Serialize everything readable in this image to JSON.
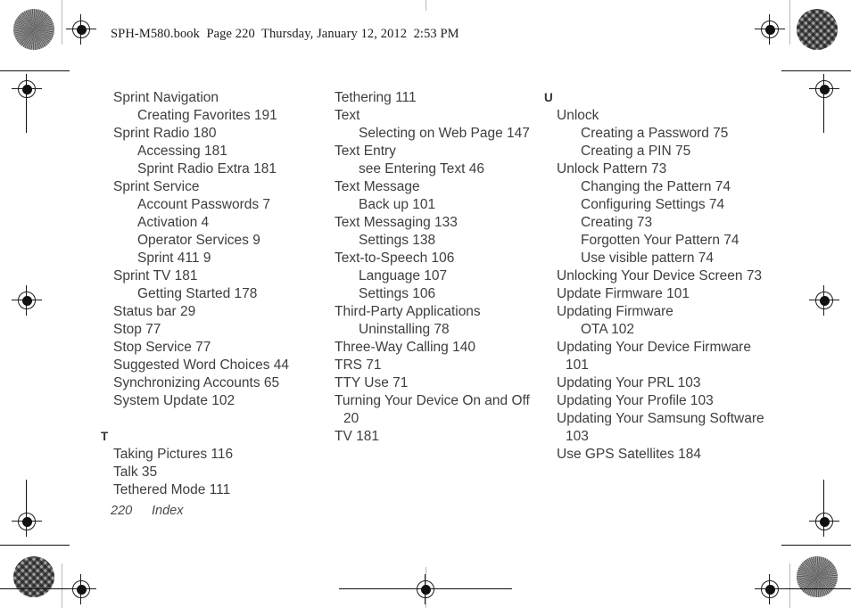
{
  "header": {
    "text": "SPH-M580.book  Page 220  Thursday, January 12, 2012  2:53 PM"
  },
  "footer": {
    "page_number": "220",
    "section_name": "Index"
  },
  "columns": [
    {
      "id": "column-1",
      "blocks": [
        {
          "type": "entry",
          "level": 1,
          "text": "Sprint Navigation"
        },
        {
          "type": "entry",
          "level": 2,
          "text": "Creating Favorites 191"
        },
        {
          "type": "entry",
          "level": 1,
          "text": "Sprint Radio 180"
        },
        {
          "type": "entry",
          "level": 2,
          "text": "Accessing 181"
        },
        {
          "type": "entry",
          "level": 2,
          "text": "Sprint Radio Extra 181"
        },
        {
          "type": "entry",
          "level": 1,
          "text": "Sprint Service"
        },
        {
          "type": "entry",
          "level": 2,
          "text": "Account Passwords 7"
        },
        {
          "type": "entry",
          "level": 2,
          "text": "Activation 4"
        },
        {
          "type": "entry",
          "level": 2,
          "text": "Operator Services 9"
        },
        {
          "type": "entry",
          "level": 2,
          "text": "Sprint 411 9"
        },
        {
          "type": "entry",
          "level": 1,
          "text": "Sprint TV 181"
        },
        {
          "type": "entry",
          "level": 2,
          "text": "Getting Started 178"
        },
        {
          "type": "entry",
          "level": 1,
          "text": "Status bar 29"
        },
        {
          "type": "entry",
          "level": 1,
          "text": "Stop 77"
        },
        {
          "type": "entry",
          "level": 1,
          "text": "Stop Service 77"
        },
        {
          "type": "entry",
          "level": 1,
          "text": "Suggested Word Choices 44"
        },
        {
          "type": "entry",
          "level": 1,
          "text": "Synchronizing Accounts 65"
        },
        {
          "type": "entry",
          "level": 1,
          "text": "System Update 102"
        },
        {
          "type": "letter",
          "text": "T"
        },
        {
          "type": "entry",
          "level": 1,
          "text": "Taking Pictures 116"
        },
        {
          "type": "entry",
          "level": 1,
          "text": "Talk 35"
        },
        {
          "type": "entry",
          "level": 1,
          "text": "Tethered Mode 111"
        }
      ]
    },
    {
      "id": "column-2",
      "blocks": [
        {
          "type": "entry",
          "level": 1,
          "text": "Tethering 111"
        },
        {
          "type": "entry",
          "level": 1,
          "text": "Text"
        },
        {
          "type": "entry",
          "level": 2,
          "text": "Selecting on Web Page 147"
        },
        {
          "type": "entry",
          "level": 1,
          "text": "Text Entry"
        },
        {
          "type": "entry",
          "level": 2,
          "text": "see Entering Text 46"
        },
        {
          "type": "entry",
          "level": 1,
          "text": "Text Message"
        },
        {
          "type": "entry",
          "level": 2,
          "text": "Back up 101"
        },
        {
          "type": "entry",
          "level": 1,
          "text": "Text Messaging 133"
        },
        {
          "type": "entry",
          "level": 2,
          "text": "Settings 138"
        },
        {
          "type": "entry",
          "level": 1,
          "text": "Text-to-Speech 106"
        },
        {
          "type": "entry",
          "level": 2,
          "text": "Language 107"
        },
        {
          "type": "entry",
          "level": 2,
          "text": "Settings 106"
        },
        {
          "type": "entry",
          "level": 1,
          "text": "Third-Party Applications"
        },
        {
          "type": "entry",
          "level": 2,
          "text": "Uninstalling 78"
        },
        {
          "type": "entry",
          "level": 1,
          "text": "Three-Way Calling 140"
        },
        {
          "type": "entry",
          "level": 1,
          "text": "TRS 71"
        },
        {
          "type": "entry",
          "level": 1,
          "text": "TTY Use 71"
        },
        {
          "type": "entry",
          "level": 1,
          "wrap": true,
          "text": "Turning Your Device On and Off 20"
        },
        {
          "type": "entry",
          "level": 1,
          "text": "TV 181"
        }
      ]
    },
    {
      "id": "column-3",
      "blocks": [
        {
          "type": "letter",
          "text": "U",
          "first": true
        },
        {
          "type": "entry",
          "level": 1,
          "text": "Unlock"
        },
        {
          "type": "entry",
          "level": 2,
          "text": "Creating a Password 75"
        },
        {
          "type": "entry",
          "level": 2,
          "text": "Creating a PIN 75"
        },
        {
          "type": "entry",
          "level": 1,
          "text": "Unlock Pattern 73"
        },
        {
          "type": "entry",
          "level": 2,
          "text": "Changing the Pattern 74"
        },
        {
          "type": "entry",
          "level": 2,
          "text": "Configuring Settings 74"
        },
        {
          "type": "entry",
          "level": 2,
          "text": "Creating 73"
        },
        {
          "type": "entry",
          "level": 2,
          "text": "Forgotten Your Pattern 74"
        },
        {
          "type": "entry",
          "level": 2,
          "text": "Use visible pattern 74"
        },
        {
          "type": "entry",
          "level": 1,
          "wrap": true,
          "text": "Unlocking Your Device Screen 73"
        },
        {
          "type": "entry",
          "level": 1,
          "text": "Update Firmware 101"
        },
        {
          "type": "entry",
          "level": 1,
          "text": "Updating Firmware"
        },
        {
          "type": "entry",
          "level": 2,
          "text": "OTA 102"
        },
        {
          "type": "entry",
          "level": 1,
          "wrap": true,
          "text": "Updating Your Device Firmware 101"
        },
        {
          "type": "entry",
          "level": 1,
          "text": "Updating Your PRL 103"
        },
        {
          "type": "entry",
          "level": 1,
          "text": "Updating Your Profile 103"
        },
        {
          "type": "entry",
          "level": 1,
          "wrap": true,
          "text": "Updating Your Samsung Software 103"
        },
        {
          "type": "entry",
          "level": 1,
          "text": "Use GPS Satellites 184"
        }
      ]
    }
  ]
}
